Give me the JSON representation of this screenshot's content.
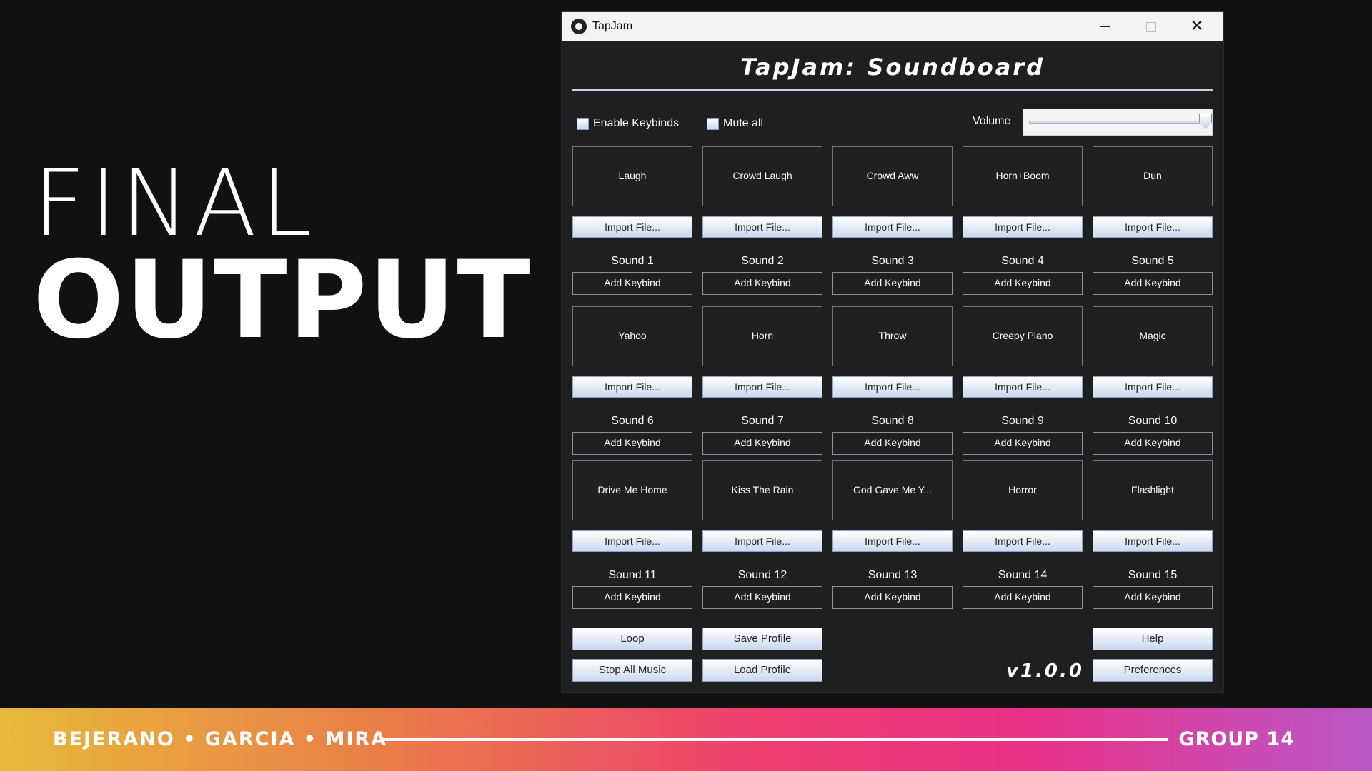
{
  "slide": {
    "heading_light": "FINAL",
    "heading_bold": "OUTPUT",
    "footer_authors": "BEJERANO • GARCIA • MIRA",
    "footer_group": "GROUP 14",
    "colors": {
      "background": "#111111",
      "gradient": [
        "#e8b93a",
        "#ea7d48",
        "#ee3f6e",
        "#e83187",
        "#bb58c9"
      ]
    }
  },
  "window": {
    "title": "TapJam",
    "icon": "tapjam-app-icon",
    "controls": [
      "minimize-icon",
      "maximize-icon",
      "close-icon"
    ]
  },
  "app": {
    "title": "TapJam: Soundboard",
    "enable_keybinds_label": "Enable Keybinds",
    "enable_keybinds_checked": false,
    "mute_all_label": "Mute all",
    "mute_all_checked": false,
    "volume_label": "Volume",
    "volume_level": 1.0,
    "version": "v1.0.0"
  },
  "sounds": [
    {
      "button": "Laugh",
      "label": "Sound 1",
      "import": "Import File...",
      "keybind": "Add Keybind"
    },
    {
      "button": "Crowd Laugh",
      "label": "Sound 2",
      "import": "Import File...",
      "keybind": "Add Keybind"
    },
    {
      "button": "Crowd Aww",
      "label": "Sound 3",
      "import": "Import File...",
      "keybind": "Add Keybind"
    },
    {
      "button": "Horn+Boom",
      "label": "Sound 4",
      "import": "Import File...",
      "keybind": "Add Keybind"
    },
    {
      "button": "Dun",
      "label": "Sound 5",
      "import": "Import File...",
      "keybind": "Add Keybind"
    },
    {
      "button": "Yahoo",
      "label": "Sound 6",
      "import": "Import File...",
      "keybind": "Add Keybind"
    },
    {
      "button": "Horn",
      "label": "Sound 7",
      "import": "Import File...",
      "keybind": "Add Keybind"
    },
    {
      "button": "Throw",
      "label": "Sound 8",
      "import": "Import File...",
      "keybind": "Add Keybind"
    },
    {
      "button": "Creepy Piano",
      "label": "Sound 9",
      "import": "Import File...",
      "keybind": "Add Keybind"
    },
    {
      "button": "Magic",
      "label": "Sound 10",
      "import": "Import File...",
      "keybind": "Add Keybind"
    },
    {
      "button": "Drive Me Home",
      "label": "Sound 11",
      "import": "Import File...",
      "keybind": "Add Keybind"
    },
    {
      "button": "Kiss The Rain",
      "label": "Sound 12",
      "import": "Import File...",
      "keybind": "Add Keybind"
    },
    {
      "button": "God Gave Me Y...",
      "label": "Sound 13",
      "import": "Import File...",
      "keybind": "Add Keybind"
    },
    {
      "button": "Horror",
      "label": "Sound 14",
      "import": "Import File...",
      "keybind": "Add Keybind"
    },
    {
      "button": "Flashlight",
      "label": "Sound 15",
      "import": "Import File...",
      "keybind": "Add Keybind"
    }
  ],
  "controls": {
    "loop": "Loop",
    "stop_all": "Stop All Music",
    "save_profile": "Save Profile",
    "load_profile": "Load Profile",
    "help": "Help",
    "preferences": "Preferences"
  }
}
